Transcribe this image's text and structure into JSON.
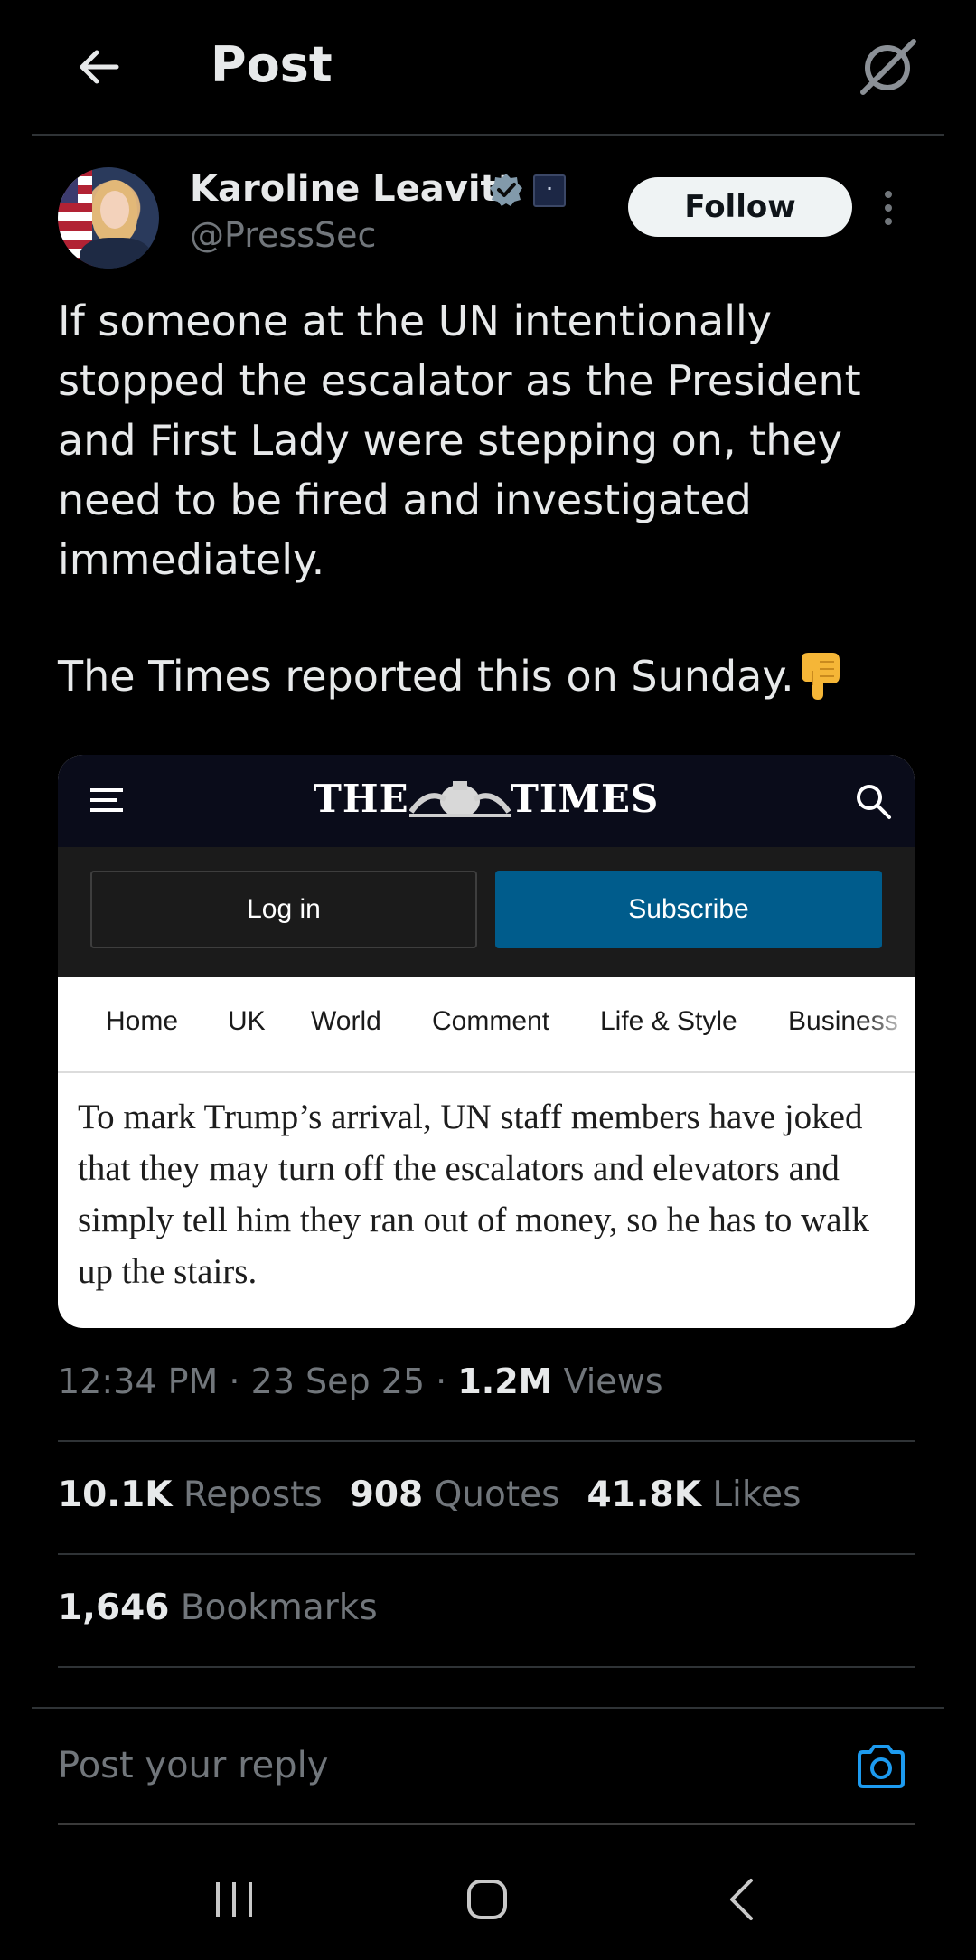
{
  "header": {
    "title": "Post"
  },
  "author": {
    "name": "Karoline Leavitt",
    "handle": "@PressSec",
    "follow_label": "Follow"
  },
  "tweet": {
    "text": "If someone at the UN intentionally stopped the escalator as the President and First Lady were stepping on, they need to be fired and investigated immediately.",
    "text2": "The Times reported this on Sunday."
  },
  "embed": {
    "logo_left": "THE",
    "logo_right": "TIMES",
    "login_label": "Log in",
    "subscribe_label": "Subscribe",
    "nav": [
      "Home",
      "UK",
      "World",
      "Comment",
      "Life & Style",
      "Business"
    ],
    "article": "To mark Trump’s arrival, UN staff members have joked that they may turn off the escalators and elevators and simply tell him they ran out of money, so he has to walk up the stairs."
  },
  "meta": {
    "time": "12:34 PM",
    "date": "23 Sep 25",
    "views_count": "1.2M",
    "views_label": "Views",
    "separator": "·"
  },
  "stats": {
    "reposts_count": "10.1K",
    "reposts_label": "Reposts",
    "quotes_count": "908",
    "quotes_label": "Quotes",
    "likes_count": "41.8K",
    "likes_label": "Likes",
    "bookmarks_count": "1,646",
    "bookmarks_label": "Bookmarks"
  },
  "reply": {
    "placeholder": "Post your reply"
  },
  "colors": {
    "accent": "#1d9bf0",
    "subscribe": "#005c8c",
    "follow_bg": "#eff3f4"
  },
  "icons": [
    "arrow-left-icon",
    "grok-icon",
    "verified-icon",
    "affiliation-badge-icon",
    "more-vertical-icon",
    "hamburger-menu-icon",
    "search-icon",
    "camera-icon",
    "recents-icon",
    "home-icon",
    "back-icon"
  ]
}
